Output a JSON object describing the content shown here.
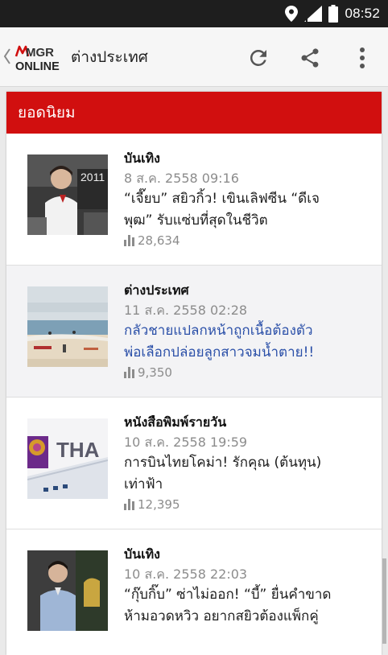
{
  "status_bar": {
    "time": "08:52",
    "icons": [
      "location-icon",
      "signal-icon",
      "battery-icon"
    ]
  },
  "app_bar": {
    "logo_top": "MGR",
    "logo_bottom": "ONLINE",
    "title": "ต่างประเทศ",
    "actions": [
      "refresh-icon",
      "share-icon",
      "more-vert-icon"
    ]
  },
  "section": {
    "title": "ยอดนิยม"
  },
  "articles": [
    {
      "category": "บันเทิง",
      "date": "8 ส.ค. 2558 09:16",
      "headline_line1": "“เจี๊ยบ” สยิวกิ้ว! เขินเลิฟซีน “ดีเจ",
      "headline_line2": "พุฒ” รับแซ่บที่สุดในชีวิต",
      "views": "28,634",
      "thumb_text": "2011"
    },
    {
      "category": "ต่างประเทศ",
      "date": "11 ส.ค. 2558 02:28",
      "headline_line1": "กลัวชายแปลกหน้าถูกเนื้อต้องตัว",
      "headline_line2": "พ่อเลือกปล่อยลูกสาวจมน้ำตาย!!",
      "views": "9,350"
    },
    {
      "category": "หนังสือพิมพ์รายวัน",
      "date": "10 ส.ค. 2558 19:59",
      "headline_line1": "การบินไทยโคม่า! รักคุณ (ต้นทุน)",
      "headline_line2": "เท่าฟ้า",
      "views": "12,395",
      "thumb_text": "THA"
    },
    {
      "category": "บันเทิง",
      "date": "10 ส.ค. 2558 22:03",
      "headline_line1": "“กุ๊บกิ๊บ” ซ่าไม่ออก! “บี้” ยื่นคำขาด",
      "headline_line2": "ห้ามอวดหวิว อยากสยิวต้องแพ็กคู่",
      "views": ""
    }
  ],
  "colors": {
    "accent": "#d10f0f",
    "link": "#2a4fa8",
    "muted": "#8c8c8c"
  }
}
